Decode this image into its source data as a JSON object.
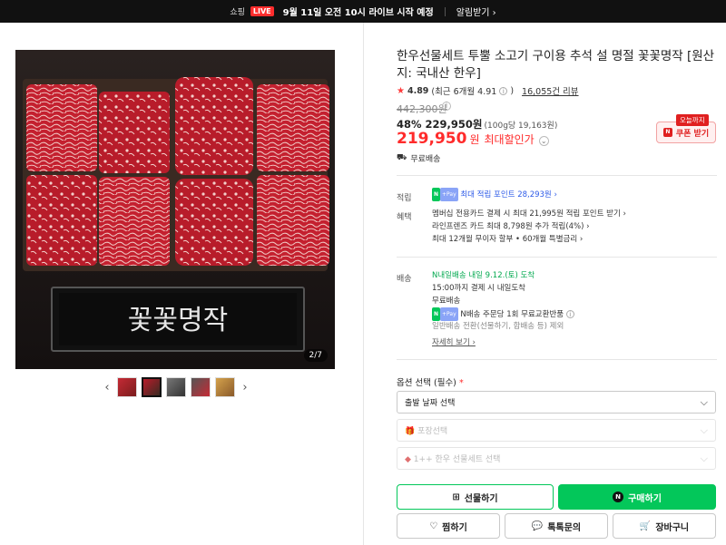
{
  "banner": {
    "shopping": "쇼핑",
    "live": "LIVE",
    "message": "9월 11일 오전 10시 라이브 시작 예정",
    "notify": "알림받기 ›"
  },
  "gallery": {
    "counter": "2/7",
    "prev_icon": "‹",
    "next_icon": "›",
    "sign_text": "꽃꽃명작"
  },
  "product": {
    "title": "한우선물세트 투뿔 소고기 구이용 추석 설 명절 꽃꽃명작 [원산지: 국내산 한우]",
    "rating": "4.89",
    "rating_sub": "(최근 6개월 4.91",
    "reviews": "16,055건 리뷰",
    "original_price": "442,300원",
    "discount": "48% 229,950원",
    "unit_price": "(100g당 19,163원)",
    "final_price": "219,950",
    "won": "원",
    "final_label": "최대할인가",
    "shipping_free": "무료배송"
  },
  "coupon": {
    "tag": "오늘까지",
    "label": "쿠폰 받기",
    "n": "N"
  },
  "benefits": {
    "points_label": "적립",
    "points_text": "최대 적립 포인트 28,293원 ›",
    "benefit_label": "혜택",
    "benefit_lines": [
      "멤버십 전용카드 결제 시 최대 21,995원 적립 포인트 받기 ›",
      "라인프렌즈 카드 최대 8,798원 추가 적립(4%) ›",
      "최대 12개월 무이자 할부 • 60개월 특별금리 ›"
    ]
  },
  "delivery": {
    "label": "배송",
    "arrival": "내일 9.12.(토) 도착",
    "brand": "N내일배송",
    "cutoff": "15:00까지 결제 시 내일도착",
    "free": "무료배송",
    "return_text": "N배송 주문당 1회 무료교환반품",
    "exclude": "일반배송 전환(선물하기, 합배송 등) 제외",
    "more": "자세히 보기 ›"
  },
  "options": {
    "label": "옵션 선택 (필수)",
    "req": "*",
    "selects": [
      {
        "text": "출발 날짜 선택",
        "disabled": false
      },
      {
        "text": "포장선택",
        "disabled": true
      },
      {
        "text": "1++ 한우 선물세트 선택",
        "disabled": true
      }
    ]
  },
  "actions": {
    "gift": "선물하기",
    "buy": "구매하기",
    "wish": "찜하기",
    "talk": "톡톡문의",
    "cart": "장바구니"
  }
}
